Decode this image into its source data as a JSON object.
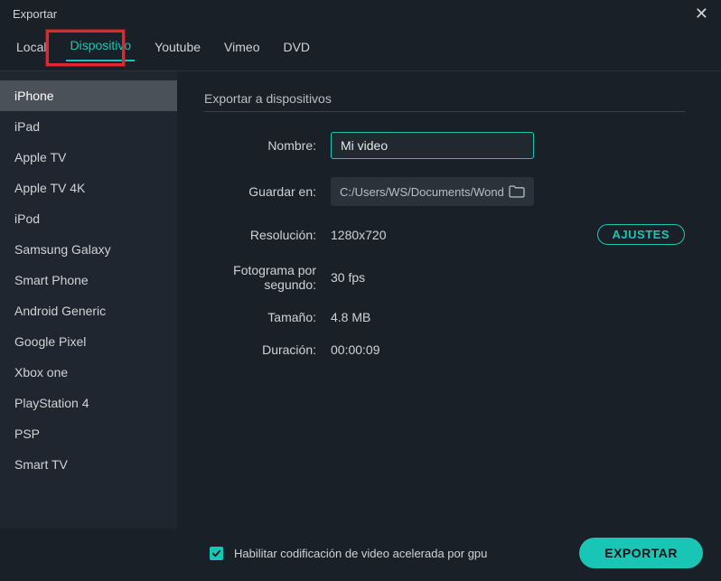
{
  "window": {
    "title": "Exportar"
  },
  "tabs": {
    "local": "Local",
    "dispositivo": "Dispositivo",
    "youtube": "Youtube",
    "vimeo": "Vimeo",
    "dvd": "DVD"
  },
  "devices": {
    "iphone": "iPhone",
    "ipad": "iPad",
    "apple_tv": "Apple TV",
    "apple_tv_4k": "Apple TV 4K",
    "ipod": "iPod",
    "samsung_galaxy": "Samsung Galaxy",
    "smart_phone": "Smart Phone",
    "android_generic": "Android Generic",
    "google_pixel": "Google Pixel",
    "xbox_one": "Xbox one",
    "playstation_4": "PlayStation 4",
    "psp": "PSP",
    "smart_tv": "Smart TV"
  },
  "section": {
    "title": "Exportar a dispositivos"
  },
  "labels": {
    "nombre": "Nombre:",
    "guardar_en": "Guardar en:",
    "resolucion": "Resolución:",
    "fps": "Fotograma por segundo:",
    "tamano": "Tamaño:",
    "duracion": "Duración:"
  },
  "values": {
    "nombre": "Mi video",
    "guardar_en": "C:/Users/WS/Documents/Wonders",
    "resolucion": "1280x720",
    "fps": "30 fps",
    "tamano": "4.8 MB",
    "duracion": "00:00:09"
  },
  "buttons": {
    "ajustes": "AJUSTES",
    "exportar": "EXPORTAR"
  },
  "footer": {
    "gpu_label": "Habilitar codificación de video acelerada por gpu",
    "gpu_checked": true
  },
  "colors": {
    "accent": "#19c6b5",
    "highlight": "#e4262c"
  }
}
